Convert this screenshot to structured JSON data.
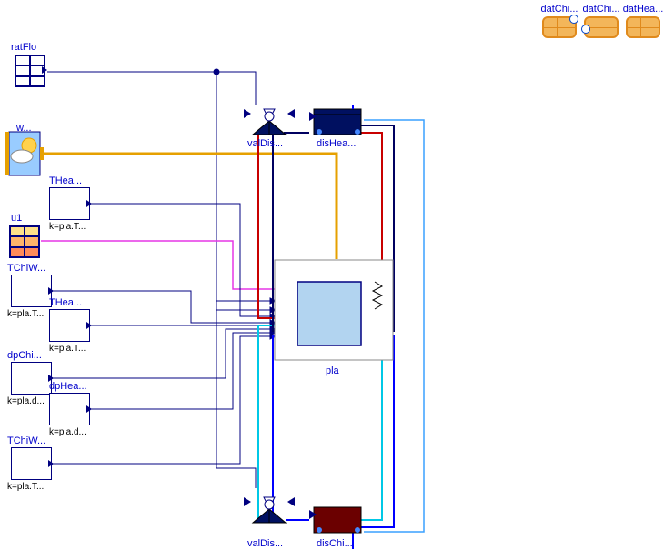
{
  "records": [
    {
      "name": "datChi...",
      "dot": "top-right"
    },
    {
      "name": "datChi...",
      "dot": "left"
    },
    {
      "name": "datHea...",
      "dot": "none"
    }
  ],
  "blocks": {
    "ratFlo": {
      "label": "ratFlo"
    },
    "weather": {
      "label": "w..."
    },
    "u1": {
      "label": "u1"
    },
    "THea": {
      "label": "THea...",
      "sub": "k=pla.T..."
    },
    "TChiW": {
      "label": "TChiW...",
      "sub": "k=pla.T..."
    },
    "THea2": {
      "label": "THea...",
      "sub": "k=pla.T..."
    },
    "dpChi": {
      "label": "dpChi...",
      "sub": "k=pla.d..."
    },
    "dpHea": {
      "label": "dpHea...",
      "sub": "k=pla.d..."
    },
    "TChiW2": {
      "label": "TChiW...",
      "sub": "k=pla.T..."
    },
    "valDisTop": {
      "label": "valDis..."
    },
    "disHea": {
      "label": "disHea..."
    },
    "valDisBot": {
      "label": "valDis..."
    },
    "disChi": {
      "label": "disChi..."
    },
    "pla": {
      "label": "pla"
    }
  }
}
